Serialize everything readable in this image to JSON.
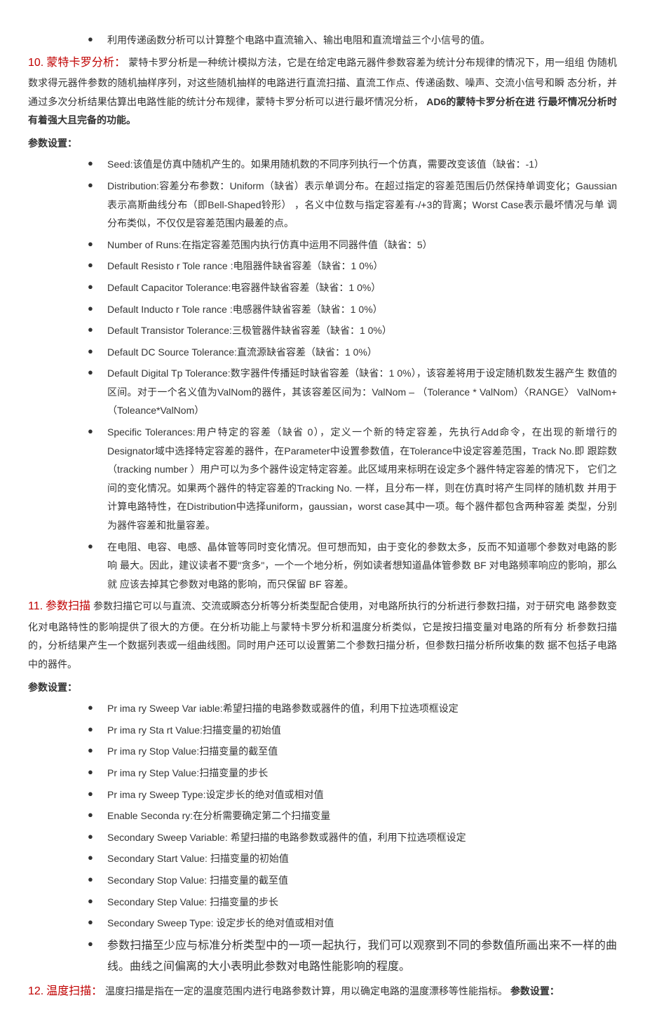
{
  "intro_bullet": "利用传递函数分析可以计算整个电路中直流输入、输出电阻和直流增益三个小信号的值。",
  "sec10": {
    "num": "10.",
    "title": "蒙特卡罗分析：",
    "body1": "蒙特卡罗分析是一种统计模拟方法，它是在给定电路元器件参数容差为统计分布规律的情况下，用一组组  伪随机数求得元器件参数的随机抽样序列，对这些随机抽样的电路进行直流扫描、直流工作点、传递函数、噪声、交流小信号和瞬   态分析，并通过多次分析结果估算出电路性能的统计分布规律，蒙特卡罗分析可以进行最坏情况分析，",
    "body1_bold": "AD6的蒙特卡罗分析在进  行最坏情况分析时有着强大且完备的功能。",
    "params_label": "参数设置：",
    "bullets": [
      "Seed:该值是仿真中随机产生的。如果用随机数的不同序列执行一个仿真，需要改变该值（缺省：-1）",
      "Distribution:容差分布参数：Uniform（缺省）表示单调分布。在超过指定的容差范围后仍然保持单调变化；Gaussian 表示高斯曲线分布（即Bell-Shaped铃形） ，名义中位数与指定容差有-/+3的背离；Worst Case表示最坏情况与单   调分布类似，不仅仅是容差范围内最差的点。",
      "Number of Runs:在指定容差范围内执行仿真中运用不同器件值（缺省：5）",
      "Default Resisto r Tole rance :电阻器件缺省容差（缺省：1  0%）",
      "Default Capacitor Tolerance:电容器件缺省容差（缺省：1  0%）",
      "Default Inducto r Tole rance :电感器件缺省容差（缺省：1  0%）",
      "Default Transistor Tolerance:三极管器件缺省容差（缺省：1  0%）",
      "Default DC Source Tolerance:直流源缺省容差（缺省：1  0%）",
      "Default Digital Tp Tolerance:数字器件传播延时缺省容差（缺省：1  0%），该容差将用于设定随机数发生器产生  数值的区间。对于一个名义值为ValNom的器件，其该容差区间为：ValNom  – （Tolerance * ValNom）〈RANGE〉 ValNom+ （Toleance*ValNom）",
      "Specific Tolerances:用户特定的容差（缺省  0），定义一个新的特定容差，先执行Add命令，在出现的新增行的  Designator域中选择特定容差的器件，在Parameter中设置参数值，在Tolerance中设定容差范围，Track    No.即    跟踪数（tracking number  ）用户可以为多个器件设定特定容差。此区域用来标明在设定多个器件特定容差的情况下，   它们之间的变化情况。如果两个器件的特定容差的Tracking   No.   一样，且分布一样，则在仿真时将产生同样的随机数    并用于计算电路特性，在Distribution中选择uniform，gaussian，worst case其中一项。每个器件都包含两种容差  类型，分别为器件容差和批量容差。",
      "在电阻、电容、电感、晶体管等同时变化情况。但可想而知，由于变化的参数太多，反而不知道哪个参数对电路的影响    最大。因此，建议读者不要\"贪多\"，一个一个地分析，例如读者想知道晶体管参数  BF 对电路频率响应的影响，那么就   应该去掉其它参数对电路的影响，而只保留  BF 容差。"
    ]
  },
  "sec11": {
    "num": "11.",
    "title": "参数扫描",
    "body": " 参数扫描它可以与直流、交流或瞬态分析等分析类型配合使用，对电路所执行的分析进行参数扫描，对于研究电    路参数变化对电路特性的影响提供了很大的方便。在分析功能上与蒙特卡罗分析和温度分析类似，它是按扫描变量对电路的所有分   析参数扫描的，分析结果产生一个数据列表或一组曲线图。同时用户还可以设置第二个参数扫描分析，但参数扫描分析所收集的数   据不包括子电路中的器件。",
    "params_label": "参数设置：",
    "bullets": [
      "Pr ima ry Sweep Var iable:希望扫描的电路参数或器件的值，利用下拉选项框设定",
      "Pr ima ry Sta rt Value:扫描变量的初始值",
      "Pr ima ry Stop Value:扫描变量的截至值",
      "Pr ima ry Step Value:扫描变量的步长",
      "Pr ima ry Sweep Type:设定步长的绝对值或相对值",
      "Enable Seconda ry:在分析需要确定第二个扫描变量",
      "Secondary Sweep Variable: 希望扫描的电路参数或器件的值，利用下拉选项框设定",
      "Secondary  Start Value: 扫描变量的初始值",
      "Secondary  Stop Value: 扫描变量的截至值",
      "Secondary  Step Value: 扫描变量的步长",
      "Secondary  Sweep Type: 设定步长的绝对值或相对值",
      "参数扫描至少应与标准分析类型中的一项一起执行，我们可以观察到不同的参数值所画出来不一样的曲线。曲线之间偏离的大小表明此参数对电路性能影响的程度。"
    ]
  },
  "sec12": {
    "num": "12.",
    "title": "温度扫描：",
    "body": "温度扫描是指在一定的温度范围内进行电路参数计算，用以确定电路的温度漂移等性能指标。",
    "params_label": "参数设置："
  }
}
